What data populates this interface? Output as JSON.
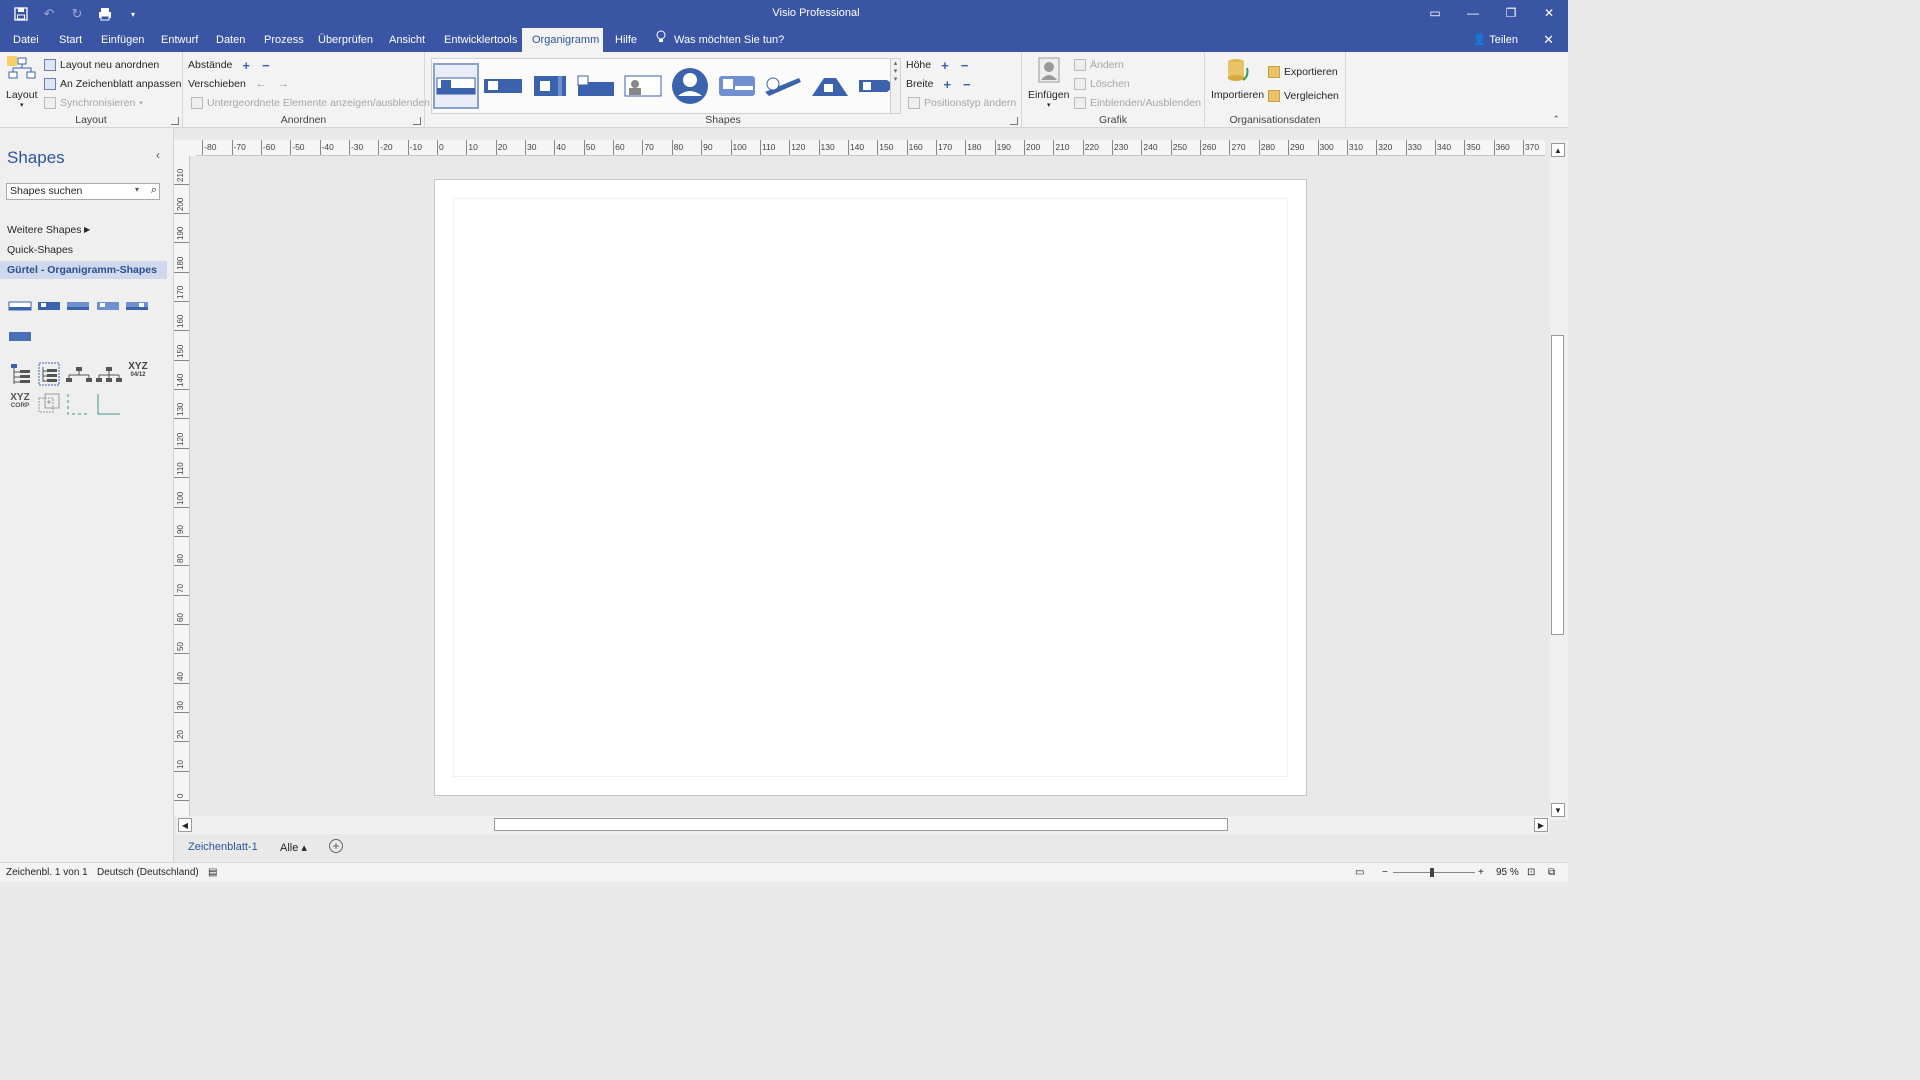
{
  "app": {
    "title": "Visio Professional",
    "qat_icons": [
      "save-icon",
      "undo-icon",
      "redo-icon",
      "print-icon",
      "customize-qat-icon"
    ],
    "window_buttons": [
      "ribbon-display-icon",
      "minimize-icon",
      "restore-icon",
      "close-icon"
    ]
  },
  "tabs": {
    "items": [
      "Datei",
      "Start",
      "Einfügen",
      "Entwurf",
      "Daten",
      "Prozess",
      "Überprüfen",
      "Ansicht",
      "Entwicklertools",
      "Organigramm",
      "Hilfe"
    ],
    "active": "Organigramm",
    "tellme": "Was möchten Sie tun?",
    "share": "Teilen"
  },
  "ribbon": {
    "layout": {
      "big_button": "Layout",
      "relayout": "Layout neu anordnen",
      "fit_page": "An Zeichenblatt anpassen",
      "sync": "Synchronisieren",
      "label": "Layout"
    },
    "arrange": {
      "spacing": "Abstände",
      "move": "Verschieben",
      "show_hide": "Untergeordnete Elemente anzeigen/ausblenden",
      "label": "Anordnen"
    },
    "shapes": {
      "height": "Höhe",
      "width": "Breite",
      "change_type": "Positionstyp ändern",
      "label": "Shapes"
    },
    "picture": {
      "insert": "Einfügen",
      "change": "Ändern",
      "delete": "Löschen",
      "show_hide": "Einblenden/Ausblenden",
      "label": "Grafik"
    },
    "org_data": {
      "import": "Importieren",
      "export": "Exportieren",
      "compare": "Vergleichen",
      "label": "Organisationsdaten"
    }
  },
  "shapes_pane": {
    "title": "Shapes",
    "search_placeholder": "Shapes suchen",
    "more_shapes": "Weitere Shapes",
    "quick_shapes": "Quick-Shapes",
    "active_stencil": "Gürtel - Organigramm-Shapes",
    "xyz1_top": "XYZ",
    "xyz1_bottom": "04/12",
    "xyz2_top": "XYZ",
    "xyz2_bottom": "CORP"
  },
  "sheet_tabs": {
    "sheet": "Zeichenblatt-1",
    "all": "Alle ▴",
    "add": "+"
  },
  "status": {
    "page_info": "Zeichenbl. 1 von 1",
    "language": "Deutsch (Deutschland)",
    "zoom": "95 %",
    "zoom_minus": "−",
    "zoom_plus": "+"
  }
}
